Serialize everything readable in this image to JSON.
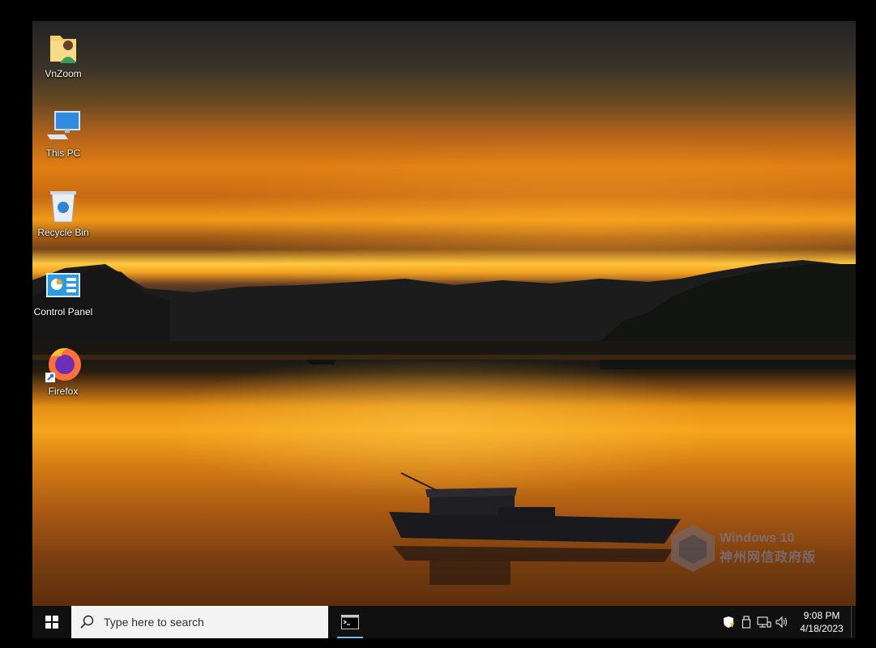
{
  "desktop": {
    "icons": [
      {
        "label": "VnZoom"
      },
      {
        "label": "This PC"
      },
      {
        "label": "Recycle Bin"
      },
      {
        "label": "Control Panel"
      },
      {
        "label": "Firefox"
      }
    ],
    "watermark": {
      "title": "Windows 10",
      "subtitle": "神州网信政府版"
    }
  },
  "taskbar": {
    "start_icon": "windows-logo-icon",
    "search": {
      "placeholder": "Type here to search"
    },
    "apps": [
      {
        "icon": "command-prompt-icon"
      }
    ],
    "tray": {
      "icons": [
        "security-shield-icon",
        "usb-drive-icon",
        "network-icon",
        "volume-icon"
      ],
      "time": "9:08 PM",
      "date": "4/18/2023"
    }
  }
}
